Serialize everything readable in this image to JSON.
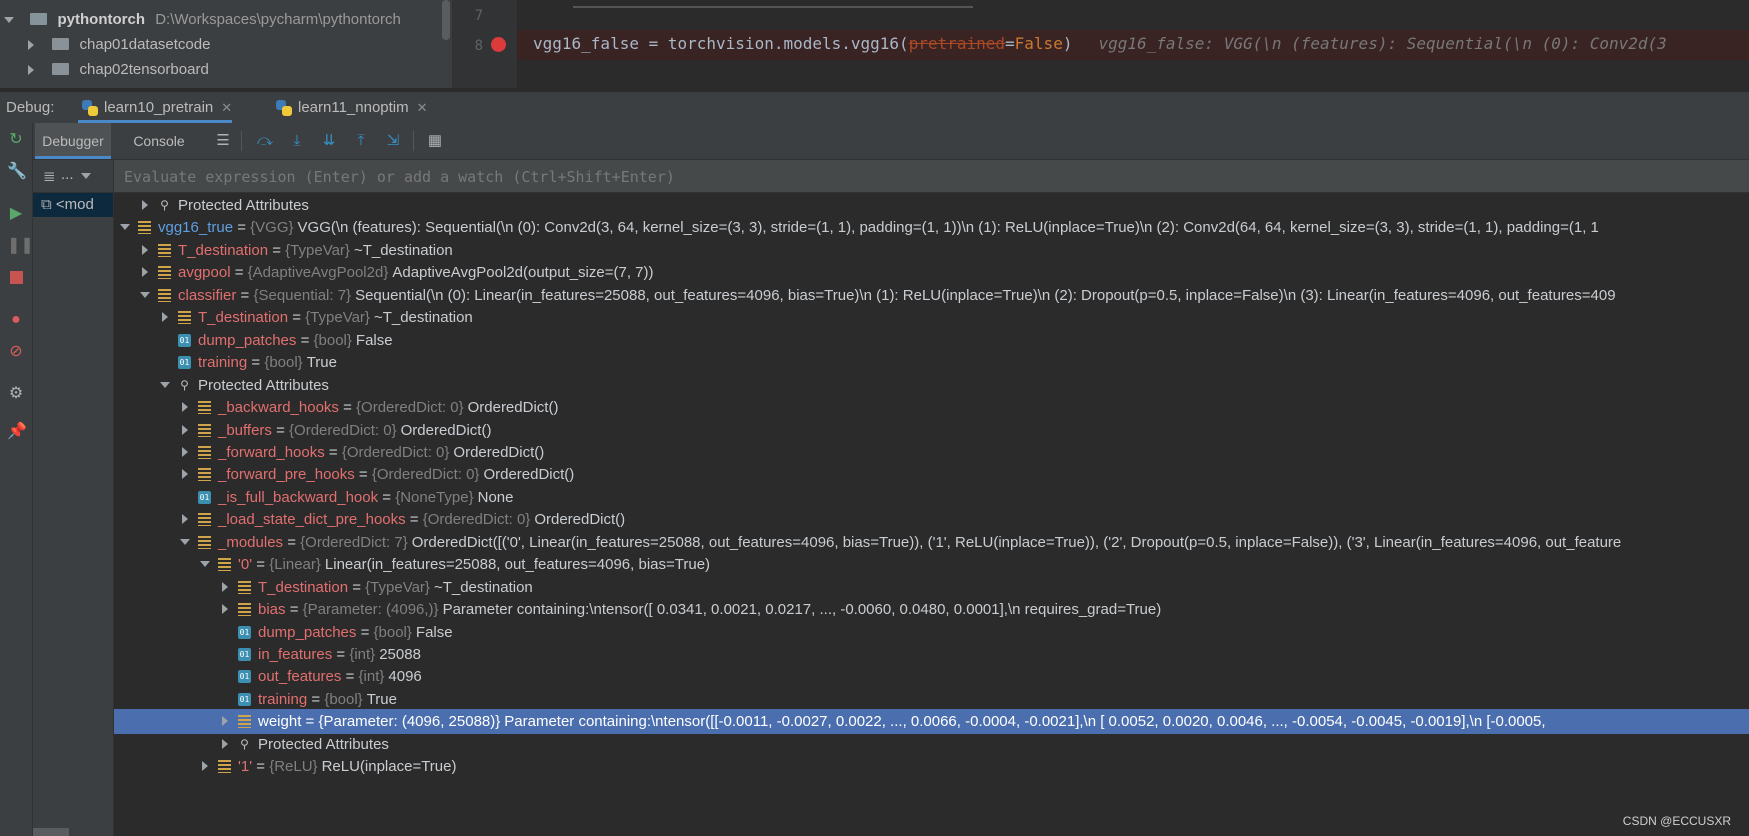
{
  "project": {
    "root_name": "pythontorch",
    "root_path": "D:\\Workspaces\\pycharm\\pythontorch",
    "items": [
      "chap01datasetcode",
      "chap02tensorboard"
    ]
  },
  "editor": {
    "line_top": "7",
    "line_num": "8",
    "code_var": "vgg16_false",
    "code_eq": " = torchvision.models.vgg16(",
    "code_param": "pretrained",
    "code_assign": "=",
    "code_false": "False",
    "code_close": ")",
    "inline_value": "vgg16_false: VGG(\\n  (features): Sequential(\\n    (0): Conv2d(3"
  },
  "debug_bar": {
    "label": "Debug:",
    "tabs": [
      "learn10_pretrain",
      "learn11_nnoptim"
    ]
  },
  "debugger_toolbar": {
    "tabs": [
      "Debugger",
      "Console"
    ]
  },
  "frames": {
    "header": "...",
    "selected": "<mod"
  },
  "watch": {
    "placeholder": "Evaluate expression (Enter) or add a watch (Ctrl+Shift+Enter)"
  },
  "rows": [
    {
      "name": "Protected Attributes",
      "type": "",
      "value": "",
      "icon": "prot",
      "toggle": "right"
    },
    {
      "name": "vgg16_true",
      "type": "{VGG}",
      "value": "VGG(\\n  (features): Sequential(\\n    (0): Conv2d(3, 64, kernel_size=(3, 3), stride=(1, 1), padding=(1, 1))\\n    (1): ReLU(inplace=True)\\n    (2): Conv2d(64, 64, kernel_size=(3, 3), stride=(1, 1), padding=(1, 1",
      "icon": "list",
      "toggle": "down"
    },
    {
      "name": "T_destination",
      "type": "{TypeVar}",
      "value": "~T_destination",
      "icon": "list",
      "toggle": "right"
    },
    {
      "name": "avgpool",
      "type": "{AdaptiveAvgPool2d}",
      "value": "AdaptiveAvgPool2d(output_size=(7, 7))",
      "icon": "list",
      "toggle": "right"
    },
    {
      "name": "classifier",
      "type": "{Sequential: 7}",
      "value": "Sequential(\\n  (0): Linear(in_features=25088, out_features=4096, bias=True)\\n  (1): ReLU(inplace=True)\\n  (2): Dropout(p=0.5, inplace=False)\\n  (3): Linear(in_features=4096, out_features=409",
      "icon": "list",
      "toggle": "down"
    },
    {
      "name": "T_destination",
      "type": "{TypeVar}",
      "value": "~T_destination",
      "icon": "list",
      "toggle": "right"
    },
    {
      "name": "dump_patches",
      "type": "{bool}",
      "value": "False",
      "icon": "prim",
      "toggle": "none"
    },
    {
      "name": "training",
      "type": "{bool}",
      "value": "True",
      "icon": "prim",
      "toggle": "none"
    },
    {
      "name": "Protected Attributes",
      "type": "",
      "value": "",
      "icon": "prot",
      "toggle": "down"
    },
    {
      "name": "_backward_hooks",
      "type": "{OrderedDict: 0}",
      "value": "OrderedDict()",
      "icon": "list",
      "toggle": "right"
    },
    {
      "name": "_buffers",
      "type": "{OrderedDict: 0}",
      "value": "OrderedDict()",
      "icon": "list",
      "toggle": "right"
    },
    {
      "name": "_forward_hooks",
      "type": "{OrderedDict: 0}",
      "value": "OrderedDict()",
      "icon": "list",
      "toggle": "right"
    },
    {
      "name": "_forward_pre_hooks",
      "type": "{OrderedDict: 0}",
      "value": "OrderedDict()",
      "icon": "list",
      "toggle": "right"
    },
    {
      "name": "_is_full_backward_hook",
      "type": "{NoneType}",
      "value": "None",
      "icon": "prim",
      "toggle": "none"
    },
    {
      "name": "_load_state_dict_pre_hooks",
      "type": "{OrderedDict: 0}",
      "value": "OrderedDict()",
      "icon": "list",
      "toggle": "right"
    },
    {
      "name": "_modules",
      "type": "{OrderedDict: 7}",
      "value": "OrderedDict([('0', Linear(in_features=25088, out_features=4096, bias=True)), ('1', ReLU(inplace=True)), ('2', Dropout(p=0.5, inplace=False)), ('3', Linear(in_features=4096, out_feature",
      "icon": "list",
      "toggle": "down"
    },
    {
      "name": "'0'",
      "type": "{Linear}",
      "value": "Linear(in_features=25088, out_features=4096, bias=True)",
      "icon": "list",
      "toggle": "down"
    },
    {
      "name": "T_destination",
      "type": "{TypeVar}",
      "value": "~T_destination",
      "icon": "list",
      "toggle": "right"
    },
    {
      "name": "bias",
      "type": "{Parameter: (4096,)}",
      "value": "Parameter containing:\\ntensor([ 0.0341,  0.0021,  0.0217,  ..., -0.0060,  0.0480,  0.0001],\\n       requires_grad=True)",
      "icon": "list",
      "toggle": "right"
    },
    {
      "name": "dump_patches",
      "type": "{bool}",
      "value": "False",
      "icon": "prim",
      "toggle": "none"
    },
    {
      "name": "in_features",
      "type": "{int}",
      "value": "25088",
      "icon": "prim",
      "toggle": "none"
    },
    {
      "name": "out_features",
      "type": "{int}",
      "value": "4096",
      "icon": "prim",
      "toggle": "none"
    },
    {
      "name": "training",
      "type": "{bool}",
      "value": "True",
      "icon": "prim",
      "toggle": "none"
    },
    {
      "name": "weight",
      "type": "{Parameter: (4096, 25088)}",
      "value": "Parameter containing:\\ntensor([[-0.0011, -0.0027,  0.0022,  ...,  0.0066, -0.0004, -0.0021],\\n        [ 0.0052,  0.0020,  0.0046,  ..., -0.0054, -0.0045, -0.0019],\\n        [-0.0005,",
      "icon": "list",
      "toggle": "right",
      "selected": true
    },
    {
      "name": "Protected Attributes",
      "type": "",
      "value": "",
      "icon": "prot",
      "toggle": "right"
    },
    {
      "name": "'1'",
      "type": "{ReLU}",
      "value": "ReLU(inplace=True)",
      "icon": "list",
      "toggle": "right"
    }
  ],
  "watermark": "CSDN @ECCUSXR"
}
